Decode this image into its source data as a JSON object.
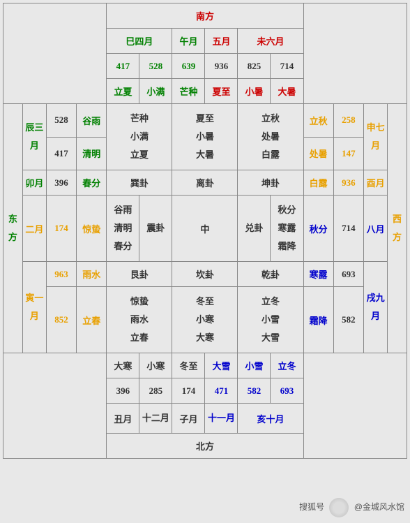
{
  "directions": {
    "south": "南方",
    "north": "北方",
    "east": "东方",
    "west": "西方"
  },
  "south_block": {
    "months": {
      "si": "巳四月",
      "wu_a": "午月",
      "wu_b": "五月",
      "wei": "未六月"
    },
    "nums": [
      "417",
      "528",
      "639",
      "936",
      "825",
      "714"
    ],
    "terms": [
      "立夏",
      "小满",
      "芒种",
      "夏至",
      "小暑",
      "大暑"
    ]
  },
  "east_block": {
    "chen": {
      "label": "辰三月",
      "r1_num": "528",
      "r1_term": "谷雨",
      "r2_num": "417",
      "r2_term": "清明"
    },
    "mao": {
      "label": "卯月",
      "num": "396",
      "term": "春分"
    },
    "er": {
      "label": "二月",
      "num": "174",
      "term": "惊蛰"
    },
    "yin": {
      "label": "寅一月",
      "r1_num": "963",
      "r1_term": "雨水",
      "r2_num": "852",
      "r2_term": "立春"
    }
  },
  "west_block": {
    "shen": {
      "label": "申七月",
      "r1_term": "立秋",
      "r1_num": "258",
      "r2_term": "处暑",
      "r2_num": "147"
    },
    "you": {
      "label": "酉月",
      "term": "白露",
      "num": "936"
    },
    "ba": {
      "label": "八月",
      "term": "秋分",
      "num": "714"
    },
    "xu": {
      "label": "戌九月",
      "r1_term": "寒露",
      "r1_num": "693",
      "r2_term": "霜降",
      "r2_num": "582"
    }
  },
  "north_block": {
    "terms": [
      "大寒",
      "小寒",
      "冬至",
      "大雪",
      "小雪",
      "立冬"
    ],
    "nums": [
      "396",
      "285",
      "174",
      "471",
      "582",
      "693"
    ],
    "months": {
      "chou": "丑月",
      "shier": "十二月",
      "zi": "子月",
      "shiyi": "十一月",
      "hai": "亥十月"
    }
  },
  "center": {
    "xun": {
      "gua": "巽卦",
      "lines": "芒种\n小满\n立夏"
    },
    "li": {
      "gua": "离卦",
      "lines": "夏至\n小暑\n大暑"
    },
    "kun": {
      "gua": "坤卦",
      "lines": "立秋\n处暑\n白露"
    },
    "zhen": {
      "gua": "震卦",
      "lines": "谷雨\n清明\n春分"
    },
    "mid": "中",
    "dui": {
      "gua": "兑卦",
      "lines": "秋分\n寒露\n霜降"
    },
    "gen": {
      "gua": "艮卦",
      "lines": "惊蛰\n雨水\n立春"
    },
    "kan": {
      "gua": "坎卦",
      "lines": "冬至\n小寒\n大寒"
    },
    "qian": {
      "gua": "乾卦",
      "lines": "立冬\n小雪\n大雪"
    }
  },
  "watermark": {
    "left": "搜狐号",
    "right": "@金城风水馆"
  }
}
